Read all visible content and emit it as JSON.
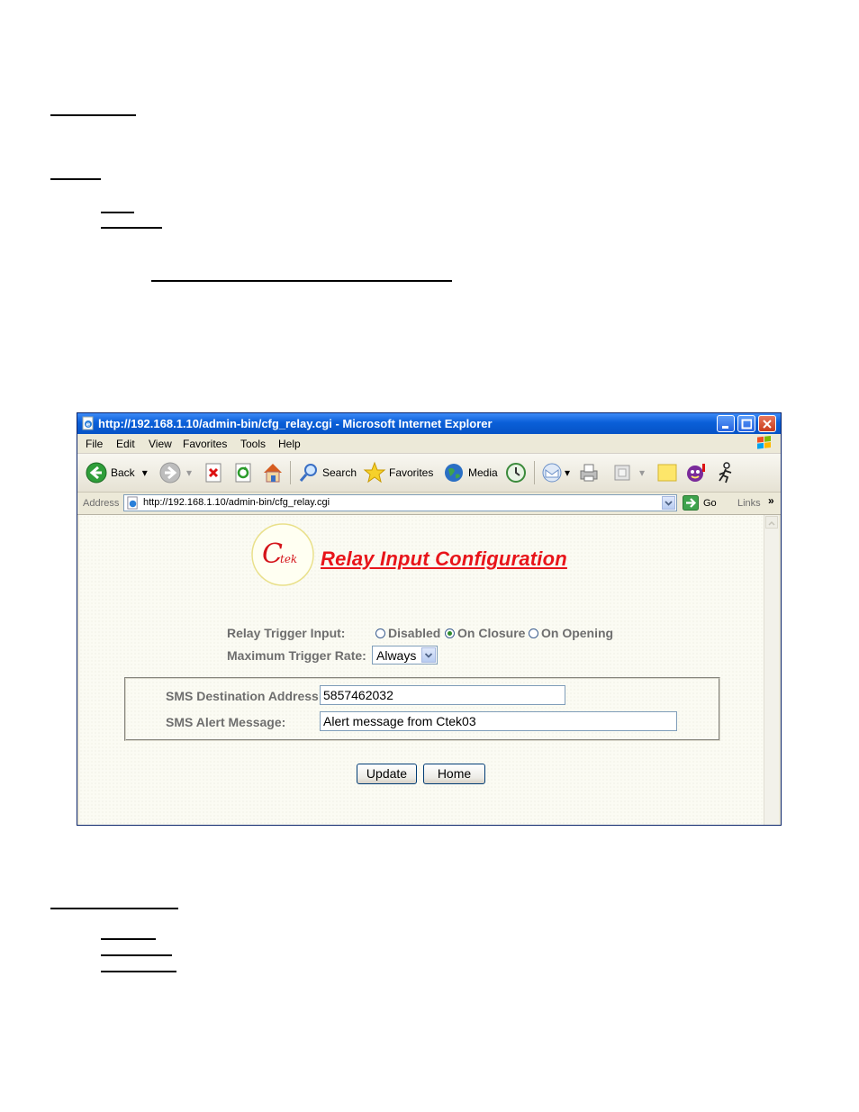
{
  "window": {
    "title": "http://192.168.1.10/admin-bin/cfg_relay.cgi - Microsoft Internet Explorer"
  },
  "menu": [
    "File",
    "Edit",
    "View",
    "Favorites",
    "Tools",
    "Help"
  ],
  "toolbar": {
    "back": "Back",
    "search": "Search",
    "favorites": "Favorites",
    "media": "Media"
  },
  "address": {
    "label": "Address",
    "url": "http://192.168.1.10/admin-bin/cfg_relay.cgi",
    "go": "Go",
    "links": "Links"
  },
  "page": {
    "logo_text": "Ctek",
    "title": "Relay Input Configuration",
    "relay_trigger_label": "Relay Trigger Input:",
    "radio_options": [
      "Disabled",
      "On Closure",
      "On Opening"
    ],
    "radio_selected": "On Closure",
    "max_rate_label": "Maximum Trigger Rate:",
    "max_rate_value": "Always",
    "sms_dest_label": "SMS Destination Address:",
    "sms_dest_value": "5857462032",
    "sms_msg_label": "SMS Alert Message:",
    "sms_msg_value": "Alert message from Ctek03",
    "update_button": "Update",
    "home_button": "Home"
  },
  "colors": {
    "title_red": "#e8141a",
    "label_gray": "#6e6e6e",
    "xp_blue": "#0a5fd8"
  }
}
